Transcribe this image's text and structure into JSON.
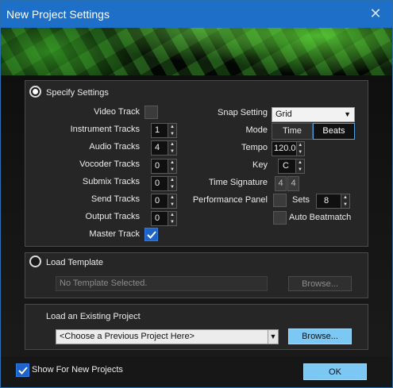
{
  "window": {
    "title": "New Project Settings",
    "close_icon": "close-icon"
  },
  "specify": {
    "label": "Specify Settings",
    "selected": true
  },
  "left_fields": [
    {
      "label": "Video Track",
      "type": "checkbox",
      "checked": false
    },
    {
      "label": "Instrument Tracks",
      "type": "spinner",
      "value": "1"
    },
    {
      "label": "Audio Tracks",
      "type": "spinner",
      "value": "4"
    },
    {
      "label": "Vocoder Tracks",
      "type": "spinner",
      "value": "0"
    },
    {
      "label": "Submix Tracks",
      "type": "spinner",
      "value": "0"
    },
    {
      "label": "Send Tracks",
      "type": "spinner",
      "value": "0"
    },
    {
      "label": "Output Tracks",
      "type": "spinner",
      "value": "0"
    },
    {
      "label": "Master Track",
      "type": "checkbox",
      "checked": true
    }
  ],
  "right": {
    "snap_label": "Snap Setting",
    "snap_value": "Grid",
    "mode_label": "Mode",
    "mode_time": "Time",
    "mode_beats": "Beats",
    "mode_selected": "Beats",
    "tempo_label": "Tempo",
    "tempo_value": "120.0",
    "key_label": "Key",
    "key_value": "C",
    "timesig_label": "Time Signature",
    "timesig_num": "4",
    "timesig_den": "4",
    "perf_label": "Performance Panel",
    "perf_checked": false,
    "sets_label": "Sets",
    "sets_value": "8",
    "auto_label": "Auto Beatmatch",
    "auto_checked": false
  },
  "template": {
    "label": "Load Template",
    "selected": false,
    "field_placeholder": "No Template Selected.",
    "browse": "Browse..."
  },
  "existing": {
    "label": "Load an Existing Project",
    "combo_value": "<Choose a Previous Project Here>",
    "browse": "Browse..."
  },
  "footer": {
    "show_label": "Show For New Projects",
    "show_checked": true,
    "ok": "OK"
  },
  "colors": {
    "titlebar": "#1e6fc7",
    "accent": "#1e63c9",
    "ok_button": "#7cc8f4"
  }
}
